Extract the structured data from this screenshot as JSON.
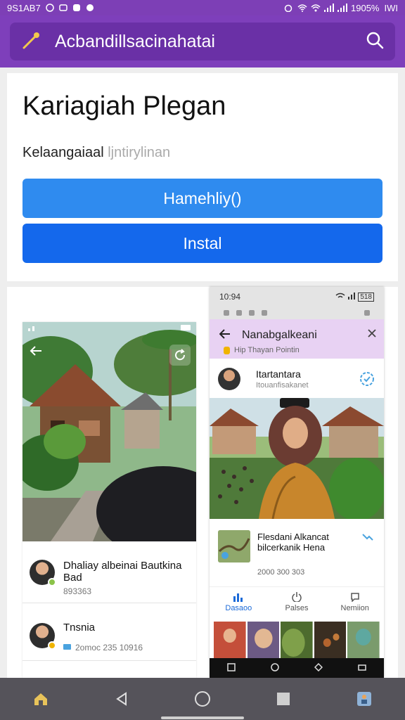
{
  "status_bar": {
    "time": "9S1AB7",
    "battery": "1905%",
    "carrier": "IWI"
  },
  "app_bar": {
    "title": "Acbandillsacinahatai"
  },
  "app": {
    "name": "Kariagiah Plegan",
    "subtitle": "Kelaangaiaal",
    "subtitle_faint": "ljntirylinan",
    "primary_button": "Hamehliy()",
    "install_button": "Instal"
  },
  "screenshot1": {
    "rows": [
      {
        "title": "Dhaliay albeinai Bautkina Bad",
        "meta": "893363"
      },
      {
        "title": "Tnsnia",
        "meta": "2omoc  235 10916"
      }
    ]
  },
  "screenshot2": {
    "status_time": "10:94",
    "battery": "518",
    "header_title": "Nanabgalkeani",
    "header_subtitle": "Hip  Thayan Pointin",
    "profile_name": "Itartantara",
    "profile_handle": "Itouanfisakanet",
    "item_title": "Flesdani Alkancat bilcerkanik Hena",
    "item_meta": "2000 300 303",
    "tabs": [
      {
        "label": "Dasaoo"
      },
      {
        "label": "Palses"
      },
      {
        "label": "Nemiion"
      }
    ]
  },
  "colors": {
    "appbar": "#7e3fbb",
    "primary_button": "#2f8bef",
    "install_button": "#1468ec",
    "accent_blue": "#1b6ad8"
  }
}
